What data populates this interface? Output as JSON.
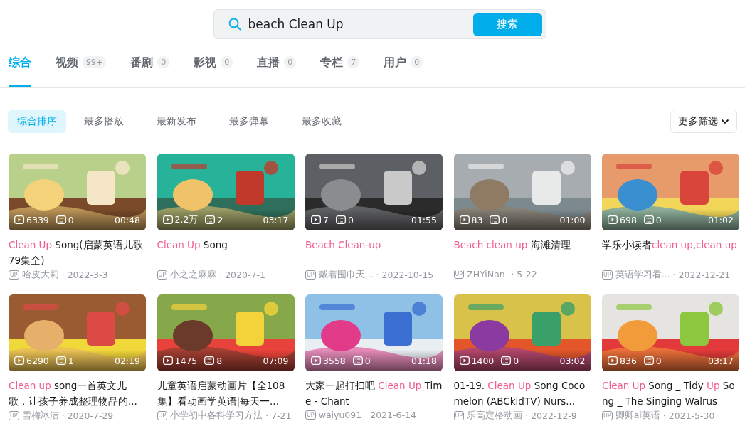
{
  "search": {
    "value": "beach Clean Up",
    "button": "搜索"
  },
  "tabs": [
    {
      "label": "综合",
      "selected": true
    },
    {
      "label": "视频",
      "count": "99+",
      "selected": false
    },
    {
      "label": "番剧",
      "count": "0",
      "selected": false
    },
    {
      "label": "影视",
      "count": "0",
      "selected": false
    },
    {
      "label": "直播",
      "count": "0",
      "selected": false
    },
    {
      "label": "专栏",
      "count": "7",
      "selected": false
    },
    {
      "label": "用户",
      "count": "0",
      "selected": false
    }
  ],
  "sort_options": [
    {
      "label": "综合排序",
      "selected": true
    },
    {
      "label": "最多播放",
      "selected": false
    },
    {
      "label": "最新发布",
      "selected": false
    },
    {
      "label": "最多弹幕",
      "selected": false
    },
    {
      "label": "最多收藏",
      "selected": false
    }
  ],
  "more_filters": "更多筛选",
  "videos": [
    {
      "views": "6339",
      "danmaku": "0",
      "duration": "00:48",
      "title": [
        {
          "text": "Clean Up",
          "highlight": true
        },
        {
          "text": " Song(启蒙英语儿歌79集全)",
          "highlight": false
        }
      ],
      "up_badge": "UP",
      "author": "哈皮大莉",
      "date": "· 2022-3-3"
    },
    {
      "views": "2.2万",
      "danmaku": "2",
      "duration": "03:17",
      "title": [
        {
          "text": "Clean Up",
          "highlight": true
        },
        {
          "text": " Song",
          "highlight": false
        }
      ],
      "up_badge": "UP",
      "author": "小之之麻麻",
      "date": "· 2020-7-1"
    },
    {
      "views": "7",
      "danmaku": "0",
      "duration": "01:55",
      "title": [
        {
          "text": "Beach Clean-up",
          "highlight": true
        }
      ],
      "up_badge": "UP",
      "author": "戴着围巾天...",
      "date": "· 2022-10-15"
    },
    {
      "views": "83",
      "danmaku": "0",
      "duration": "01:00",
      "title": [
        {
          "text": "Beach clean up",
          "highlight": true
        },
        {
          "text": " 海滩清理",
          "highlight": false
        }
      ],
      "up_badge": "UP",
      "author": "ZHYiNan-",
      "date": "· 5-22"
    },
    {
      "views": "698",
      "danmaku": "0",
      "duration": "01:02",
      "title": [
        {
          "text": "学乐小读者",
          "highlight": false
        },
        {
          "text": "clean up",
          "highlight": true
        },
        {
          "text": ",",
          "highlight": false
        },
        {
          "text": "clean up",
          "highlight": true
        }
      ],
      "up_badge": "UP",
      "author": "英语学习看...",
      "date": "· 2022-12-21"
    },
    {
      "views": "6290",
      "danmaku": "1",
      "duration": "02:19",
      "title": [
        {
          "text": "Clean up",
          "highlight": true
        },
        {
          "text": " song一首英文儿歌，让孩子养成整理物品的...",
          "highlight": false
        }
      ],
      "up_badge": "UP",
      "author": "雪梅冰洁",
      "date": "· 2020-7-29"
    },
    {
      "views": "1475",
      "danmaku": "8",
      "duration": "07:09",
      "title": [
        {
          "text": "儿童英语启蒙动画片【全108集】看动画学英语|每天一...",
          "highlight": false
        }
      ],
      "up_badge": "UP",
      "author": "小学初中各科学习方法",
      "date": "· 7-21"
    },
    {
      "views": "3558",
      "danmaku": "0",
      "duration": "01:18",
      "title": [
        {
          "text": "大家一起打扫吧 ",
          "highlight": false
        },
        {
          "text": "Clean Up",
          "highlight": true
        },
        {
          "text": " Time - Chant",
          "highlight": false
        }
      ],
      "up_badge": "UP",
      "author": "waiyu091",
      "date": "· 2021-6-14"
    },
    {
      "views": "1400",
      "danmaku": "0",
      "duration": "03:02",
      "title": [
        {
          "text": "01-19. ",
          "highlight": false
        },
        {
          "text": "Clean Up",
          "highlight": true
        },
        {
          "text": " Song Cocomelon (ABCkidTV) Nurs...",
          "highlight": false
        }
      ],
      "up_badge": "UP",
      "author": "乐高定格动画",
      "date": "· 2022-12-9"
    },
    {
      "views": "836",
      "danmaku": "0",
      "duration": "03:17",
      "title": [
        {
          "text": "Clean Up",
          "highlight": true
        },
        {
          "text": " Song _ Tidy ",
          "highlight": false
        },
        {
          "text": "Up",
          "highlight": true
        },
        {
          "text": " Song _ The Singing Walrus",
          "highlight": false
        }
      ],
      "up_badge": "UP",
      "author": "卿卿ai英语",
      "date": "· 2021-5-30"
    }
  ]
}
